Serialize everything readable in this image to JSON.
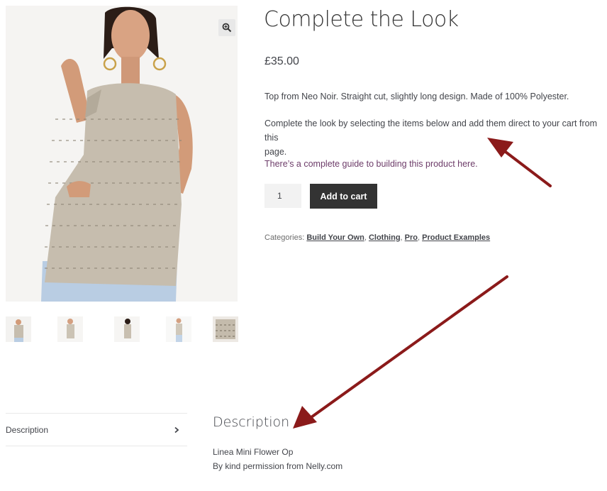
{
  "product": {
    "title": "Complete the Look",
    "price": "£35.00",
    "description_short": "Top from Neo Noir. Straight cut, slightly long design. Made of 100% Polyester.",
    "complete_look_line1": "Complete the look by selecting the items below and add them direct to your cart from this",
    "complete_look_line2": "page.",
    "guide_text": "There’s a complete guide to building this product here.",
    "quantity": "1",
    "add_to_cart_label": "Add to cart",
    "categories_label": "Categories:",
    "categories": [
      "Build Your Own",
      "Clothing",
      "Pro",
      "Product Examples"
    ],
    "separator": ","
  },
  "gallery": {
    "zoom_icon": "zoom-in-icon",
    "thumbnail_count": 5
  },
  "tabs": {
    "description_label": "Description",
    "chevron_icon": "chevron-right-icon"
  },
  "description_panel": {
    "heading": "Description",
    "line1": "Linea Mini Flower Op",
    "line2": "By kind permission from Nelly.com"
  },
  "colors": {
    "button_bg": "#333333",
    "link": "#6d3c69",
    "arrow": "#8b1a1a"
  }
}
